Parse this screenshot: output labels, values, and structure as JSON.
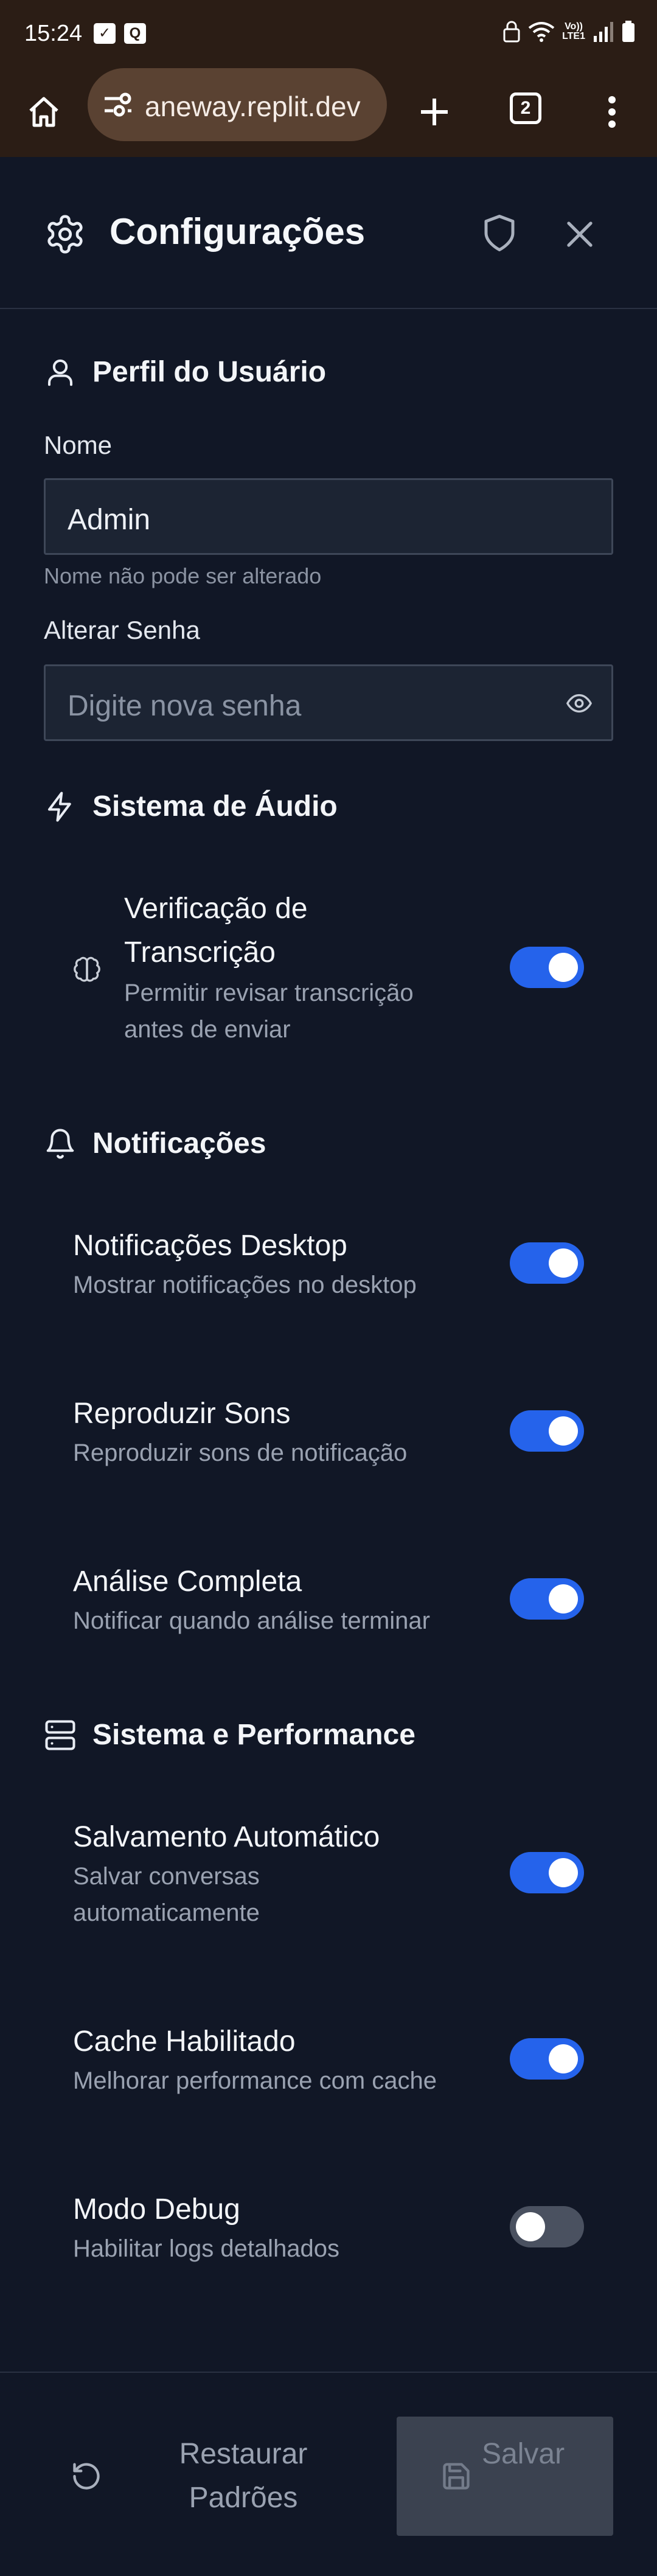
{
  "status_bar": {
    "time": "15:24",
    "notif_1": "✓",
    "notif_2": "Q",
    "volte_line1": "Vo))",
    "volte_line2": "LTE1"
  },
  "browser": {
    "url": "aneway.replit.dev",
    "tab_count": "2"
  },
  "header": {
    "title": "Configurações"
  },
  "profile": {
    "section_title": "Perfil do Usuário",
    "name_label": "Nome",
    "name_value": "Admin",
    "name_hint": "Nome não pode ser alterado",
    "password_label": "Alterar Senha",
    "password_placeholder": "Digite nova senha"
  },
  "audio": {
    "section_title": "Sistema de Áudio",
    "items": [
      {
        "title_line1": "Verificação de",
        "title_line2": "Transcrição",
        "desc_line1": "Permitir revisar transcrição",
        "desc_line2": "antes de enviar",
        "enabled": true
      }
    ]
  },
  "notifications": {
    "section_title": "Notificações",
    "items": [
      {
        "title": "Notificações Desktop",
        "desc": "Mostrar notificações no desktop",
        "enabled": true
      },
      {
        "title": "Reproduzir Sons",
        "desc": "Reproduzir sons de notificação",
        "enabled": true
      },
      {
        "title": "Análise Completa",
        "desc": "Notificar quando análise terminar",
        "enabled": true
      }
    ]
  },
  "performance": {
    "section_title": "Sistema e Performance",
    "items": [
      {
        "title": "Salvamento Automático",
        "desc_line1": "Salvar conversas",
        "desc_line2": "automaticamente",
        "enabled": true
      },
      {
        "title": "Cache Habilitado",
        "desc": "Melhorar performance com cache",
        "enabled": true
      },
      {
        "title": "Modo Debug",
        "desc": "Habilitar logs detalhados",
        "enabled": false
      }
    ]
  },
  "footer": {
    "restore_label": "Restaurar Padrões",
    "save_label": "Salvar"
  },
  "colors": {
    "background": "#111726",
    "browser_bar": "#2b1d15",
    "accent": "#2563eb",
    "toggle_off": "#4a5160"
  }
}
